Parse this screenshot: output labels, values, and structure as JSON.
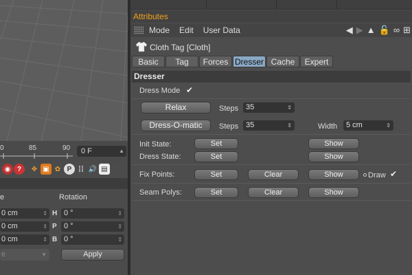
{
  "left_panel": {
    "timeline": {
      "ticks": [
        "0",
        "85",
        "90"
      ],
      "frame_value": "0 F"
    },
    "coords": {
      "headers": [
        "e",
        "Rotation"
      ],
      "rows": [
        {
          "pos": "0 cm",
          "rot_label": "H",
          "rot": "0 °"
        },
        {
          "pos": "0 cm",
          "rot_label": "P",
          "rot": "0 °"
        },
        {
          "pos": "0 cm",
          "rot_label": "B",
          "rot": "0 °"
        }
      ],
      "mode_dropdown": "e",
      "apply_label": "Apply"
    }
  },
  "attributes": {
    "title": "Attributes",
    "menu": [
      "Mode",
      "Edit",
      "User Data"
    ],
    "tag_name": "Cloth Tag [Cloth]",
    "tabs": [
      "Basic",
      "Tag",
      "Forces",
      "Dresser",
      "Cache",
      "Expert"
    ],
    "active_tab": "Dresser",
    "section_title": "Dresser",
    "dress_mode_label": "Dress Mode",
    "dress_mode_checked": true,
    "relax_label": "Relax",
    "steps_label": "Steps",
    "relax_steps": "35",
    "dressomatic_label": "Dress-O-matic",
    "dressomatic_steps": "35",
    "width_label": "Width",
    "width_value": "5 cm",
    "init_state_label": "Init State:",
    "dress_state_label": "Dress State:",
    "fix_points_label": "Fix Points:",
    "seam_polys_label": "Seam Polys:",
    "set_label": "Set",
    "show_label": "Show",
    "clear_label": "Clear",
    "draw_label": "Draw",
    "draw_checked": true
  },
  "colors": {
    "title_accent": "#f4a21a",
    "active_tab": "#8aa8c4"
  }
}
